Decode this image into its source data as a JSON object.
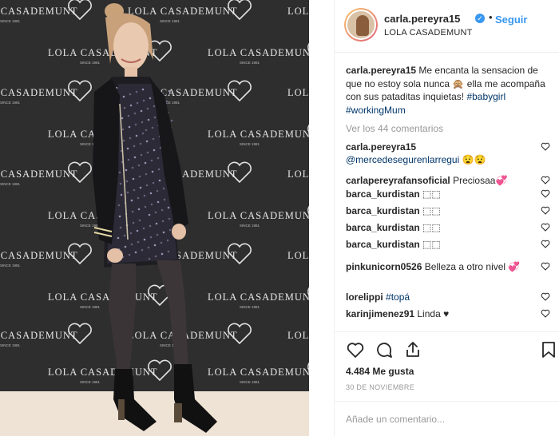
{
  "photo": {
    "description_icon": "photo",
    "backdrop_brand": "LOLA CASADEMUNT",
    "backdrop_since": "SINCE 1981"
  },
  "header": {
    "username": "carla.pereyra15",
    "follow_label": "Seguir",
    "location": "LOLA CASADEMUNT"
  },
  "caption": {
    "username": "carla.pereyra15",
    "text": " Me encanta la sensacion de que no estoy sola nunca 🙊 ella me acompaña con sus pataditas inquietas! ",
    "tag1": "#babygirl",
    "tag2": "#workingMum"
  },
  "view_all": "Ver los 44 comentarios",
  "comments": [
    {
      "user": "carla.pereyra15",
      "text": "",
      "mention": "@mercedesegurenlarregui",
      "tail": " 😧😧"
    },
    {
      "user": "carlapereyrafansoficial",
      "text": " Preciosaa💞",
      "mention": "",
      "tail": ""
    },
    {
      "user": "barca_kurdistan",
      "text": " ⬚⬚",
      "mention": "",
      "tail": ""
    },
    {
      "user": "barca_kurdistan",
      "text": " ⬚⬚",
      "mention": "",
      "tail": ""
    },
    {
      "user": "barca_kurdistan",
      "text": " ⬚⬚",
      "mention": "",
      "tail": ""
    },
    {
      "user": "barca_kurdistan",
      "text": " ⬚⬚",
      "mention": "",
      "tail": ""
    },
    {
      "user": "pinkunicorn0526",
      "text": " Belleza a otro nivel 💞",
      "mention": "",
      "tail": ""
    },
    {
      "user": "lorelippi",
      "text": " ",
      "mention": "#topá",
      "tail": ""
    },
    {
      "user": "karinjimenez91",
      "text": " Linda ♥",
      "mention": "",
      "tail": ""
    }
  ],
  "actions": {
    "like_icon": "heart-outline",
    "comment_icon": "comment-bubble",
    "share_icon": "share-arrow",
    "save_icon": "bookmark"
  },
  "likes": "4.484 Me gusta",
  "date": "30 DE NOVIEMBRE",
  "add_comment_placeholder": "Añade un comentario...",
  "colors": {
    "link_blue": "#3897f0",
    "hashtag": "#003569",
    "muted": "#999999",
    "text": "#262626"
  }
}
